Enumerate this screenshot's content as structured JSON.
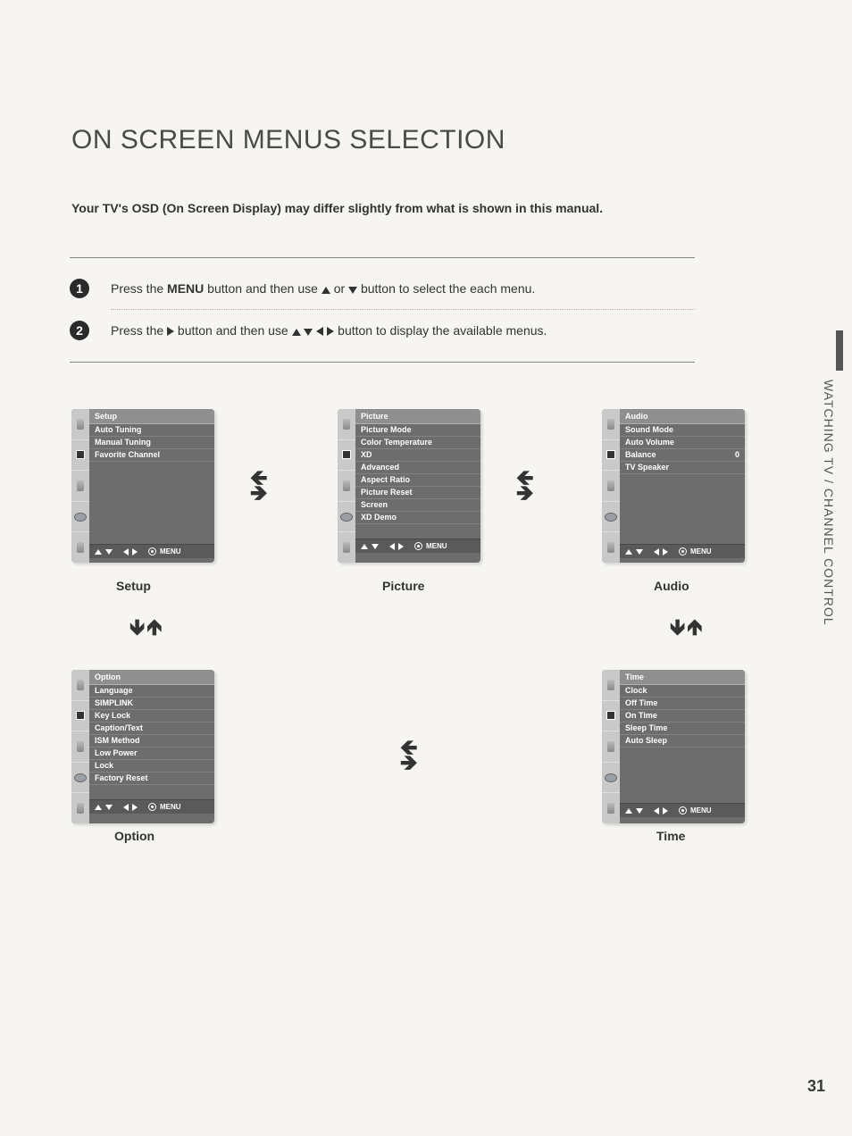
{
  "title": "ON SCREEN MENUS SELECTION",
  "intro": "Your TV's OSD (On Screen Display) may differ slightly from what is shown in this manual.",
  "step1": {
    "num": "1",
    "pre": "Press the ",
    "menu_word": "MENU",
    "mid": " button and then use ",
    "or": " or ",
    "post": " button to select the each menu."
  },
  "step2": {
    "num": "2",
    "pre": "Press the ",
    "mid": " button and then use ",
    "post": " button to display the available menus."
  },
  "footer_label": "MENU",
  "menus": {
    "setup": {
      "title": "Setup",
      "label": "Setup",
      "items": [
        "Auto Tuning",
        "Manual Tuning",
        "Favorite Channel"
      ]
    },
    "picture": {
      "title": "Picture",
      "label": "Picture",
      "items": [
        "Picture Mode",
        "Color Temperature",
        "XD",
        "Advanced",
        "Aspect Ratio",
        "Picture Reset",
        "Screen",
        "XD Demo"
      ]
    },
    "audio": {
      "title": "Audio",
      "label": "Audio",
      "items": [
        "Sound Mode",
        "Auto Volume",
        "Balance",
        "TV Speaker"
      ],
      "balance_value": "0"
    },
    "option": {
      "title": "Option",
      "label": "Option",
      "items": [
        "Language",
        "SIMPLINK",
        "Key Lock",
        "Caption/Text",
        "ISM Method",
        "Low Power",
        "Lock",
        "Factory Reset"
      ]
    },
    "time": {
      "title": "Time",
      "label": "Time",
      "items": [
        "Clock",
        "Off Time",
        "On Time",
        "Sleep Time",
        "Auto Sleep"
      ]
    }
  },
  "side_tab": "WATCHING TV / CHANNEL CONTROL",
  "page_number": "31"
}
